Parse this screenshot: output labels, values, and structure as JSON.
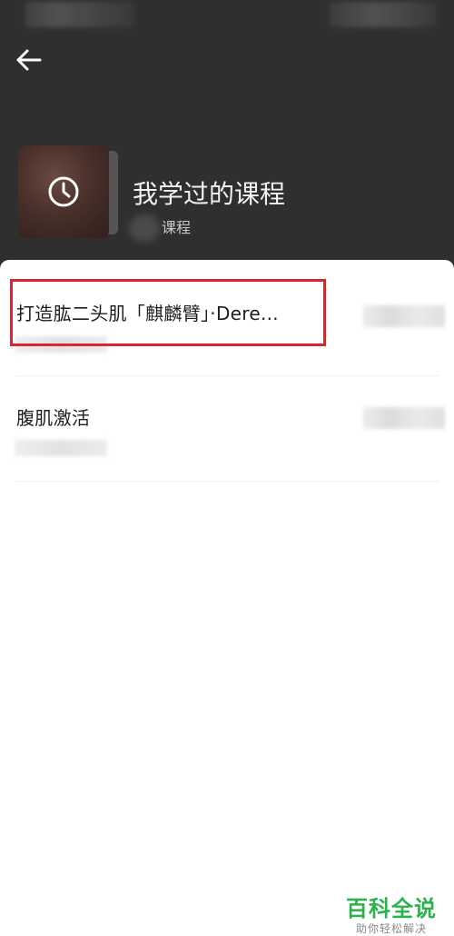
{
  "header": {
    "title": "我学过的课程",
    "subtitle": "课程",
    "back_icon": "arrow-left-icon",
    "cover_icon": "clock-icon",
    "background_color": "#2f2f2f"
  },
  "courses": [
    {
      "title": "打造肱二头肌「麒麟臂」·Dere..."
    },
    {
      "title": "腹肌激活"
    }
  ],
  "watermark": {
    "title": "百科全说",
    "subtitle": "助你轻松解决",
    "color": "#2bb24c"
  },
  "highlight_color": "#d9272b"
}
